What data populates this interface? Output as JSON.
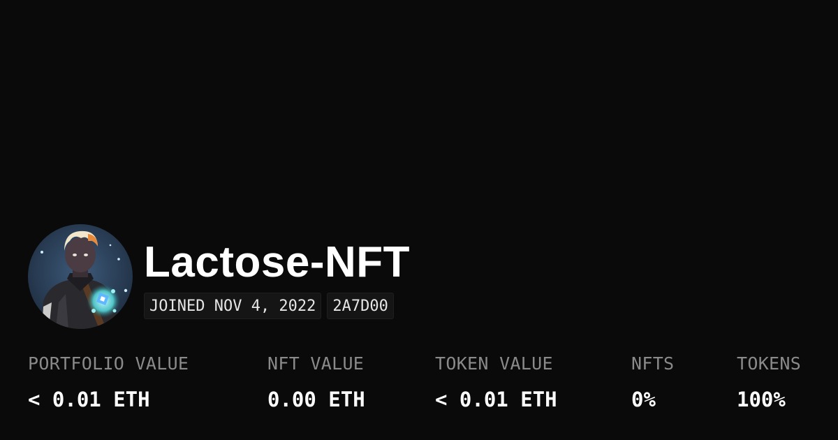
{
  "profile": {
    "name": "Lactose-NFT",
    "avatar_icon": "nft-avatar-character",
    "joined": "JOINED NOV 4, 2022",
    "address": "2A7D00"
  },
  "stats": [
    {
      "label": "PORTFOLIO VALUE",
      "value": "< 0.01 ETH"
    },
    {
      "label": "NFT VALUE",
      "value": "0.00 ETH"
    },
    {
      "label": "TOKEN VALUE",
      "value": "< 0.01 ETH"
    },
    {
      "label": "NFTS",
      "value": "0%"
    },
    {
      "label": "TOKENS",
      "value": "100%"
    }
  ],
  "colors": {
    "background": "#0a0a0a",
    "label": "#8a8a8a",
    "value": "#ffffff"
  }
}
